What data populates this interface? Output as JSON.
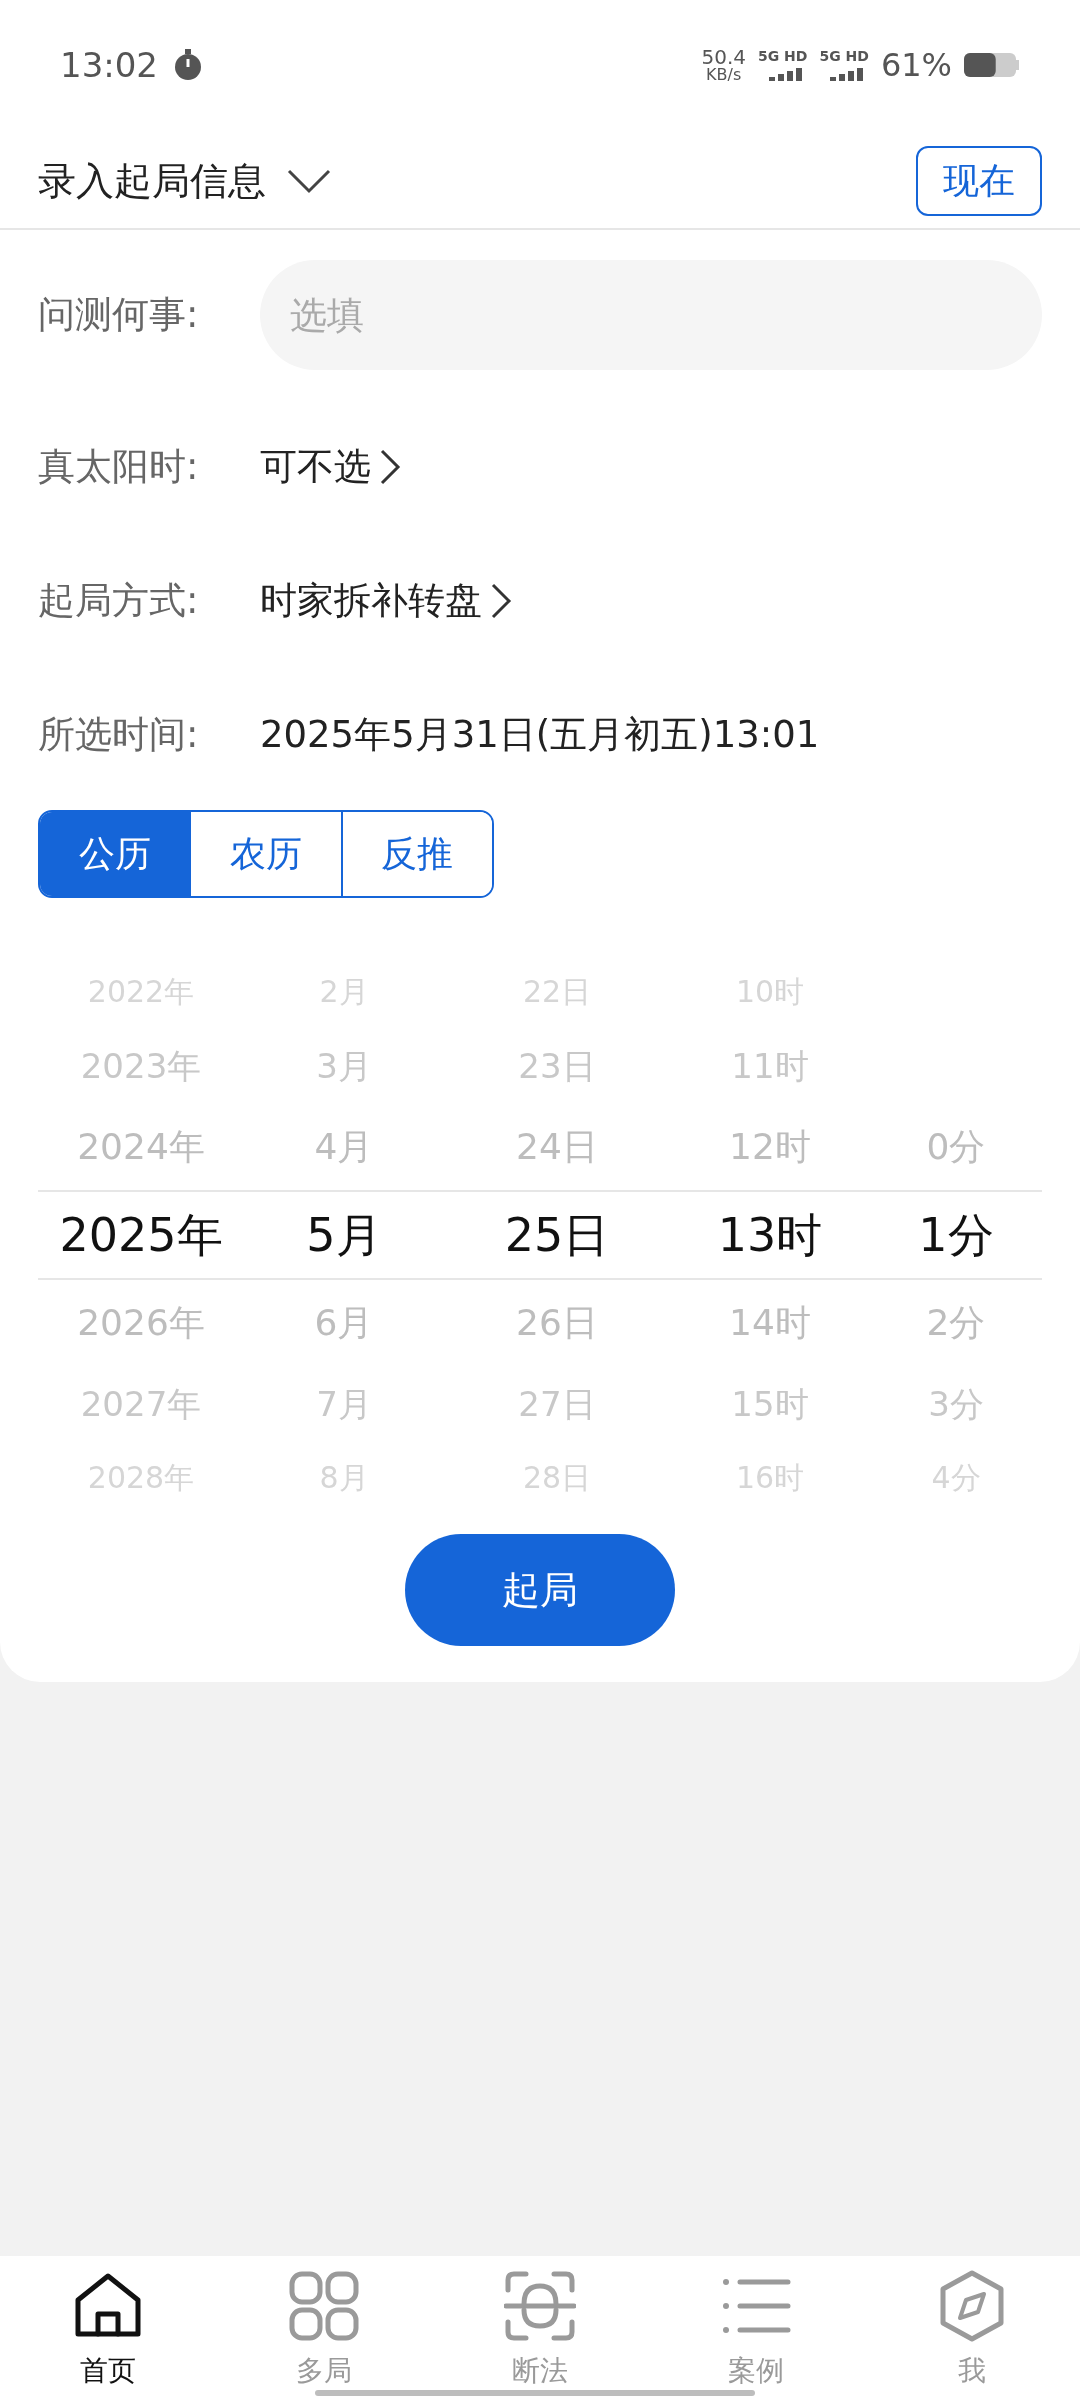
{
  "status_bar": {
    "time": "13:02",
    "speed": "50.4",
    "speed_unit": "KB/s",
    "sim1": "5G HD",
    "sim2": "5G HD",
    "battery": "61%"
  },
  "header": {
    "title": "录入起局信息",
    "now_button": "现在"
  },
  "form": {
    "question": {
      "label": "问测何事:",
      "placeholder": "选填"
    },
    "solar": {
      "label": "真太阳时:",
      "value": "可不选"
    },
    "method": {
      "label": "起局方式:",
      "value": "时家拆补转盘"
    },
    "time": {
      "label": "所选时间:",
      "value": "2025年5月31日(五月初五)13:01"
    }
  },
  "calendar_tabs": [
    {
      "label": "公历",
      "selected": true
    },
    {
      "label": "农历",
      "selected": false
    },
    {
      "label": "反推",
      "selected": false
    }
  ],
  "picker": {
    "rows": [
      {
        "selected": false,
        "cells": [
          "2022年",
          "2月",
          "22日",
          "10时"
        ]
      },
      {
        "selected": false,
        "cells": [
          "2023年",
          "3月",
          "23日",
          "11时"
        ]
      },
      {
        "selected": false,
        "cells": [
          "2024年",
          "4月",
          "24日",
          "12时",
          "0分"
        ]
      },
      {
        "selected": true,
        "cells": [
          "2025年",
          "5月",
          "25日",
          "13时",
          "1分"
        ]
      },
      {
        "selected": false,
        "cells": [
          "2026年",
          "6月",
          "26日",
          "14时",
          "2分"
        ]
      },
      {
        "selected": false,
        "cells": [
          "2027年",
          "7月",
          "27日",
          "15时",
          "3分"
        ]
      },
      {
        "selected": false,
        "cells": [
          "2028年",
          "8月",
          "28日",
          "16时",
          "4分"
        ]
      }
    ]
  },
  "submit_button": "起局",
  "bottom_nav": [
    {
      "label": "首页",
      "kind": "home",
      "selected": true
    },
    {
      "label": "多局",
      "kind": "grid",
      "selected": false
    },
    {
      "label": "断法",
      "kind": "scan",
      "selected": false
    },
    {
      "label": "案例",
      "kind": "list",
      "selected": false
    },
    {
      "label": "我",
      "kind": "compass",
      "selected": false
    }
  ]
}
